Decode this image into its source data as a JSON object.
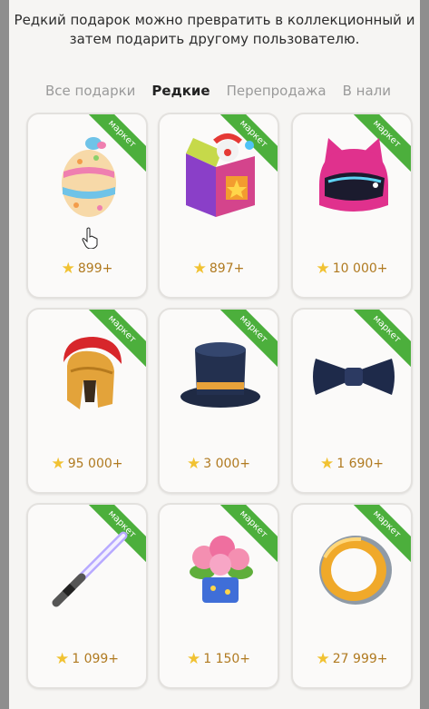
{
  "description": "Редкий подарок можно превратить в коллекционный и затем подарить другому пользователю.",
  "tabs": [
    {
      "label": "Все подарки"
    },
    {
      "label": "Редкие"
    },
    {
      "label": "Перепродажа"
    },
    {
      "label": "В нали"
    }
  ],
  "ribbon_label": "маркет",
  "gifts": [
    {
      "icon": "easter-egg-icon",
      "price": "899+"
    },
    {
      "icon": "jack-in-the-box-icon",
      "price": "897+"
    },
    {
      "icon": "cat-helmet-icon",
      "price": "10 000+"
    },
    {
      "icon": "spartan-helmet-icon",
      "price": "95 000+"
    },
    {
      "icon": "top-hat-icon",
      "price": "3 000+"
    },
    {
      "icon": "bow-tie-icon",
      "price": "1 690+"
    },
    {
      "icon": "lightsaber-icon",
      "price": "1 099+"
    },
    {
      "icon": "flower-pot-icon",
      "price": "1 150+"
    },
    {
      "icon": "gold-ring-icon",
      "price": "27 999+"
    }
  ],
  "colors": {
    "ribbon": "#4caf3c",
    "price": "#b07a20",
    "star": "#f1c232"
  }
}
